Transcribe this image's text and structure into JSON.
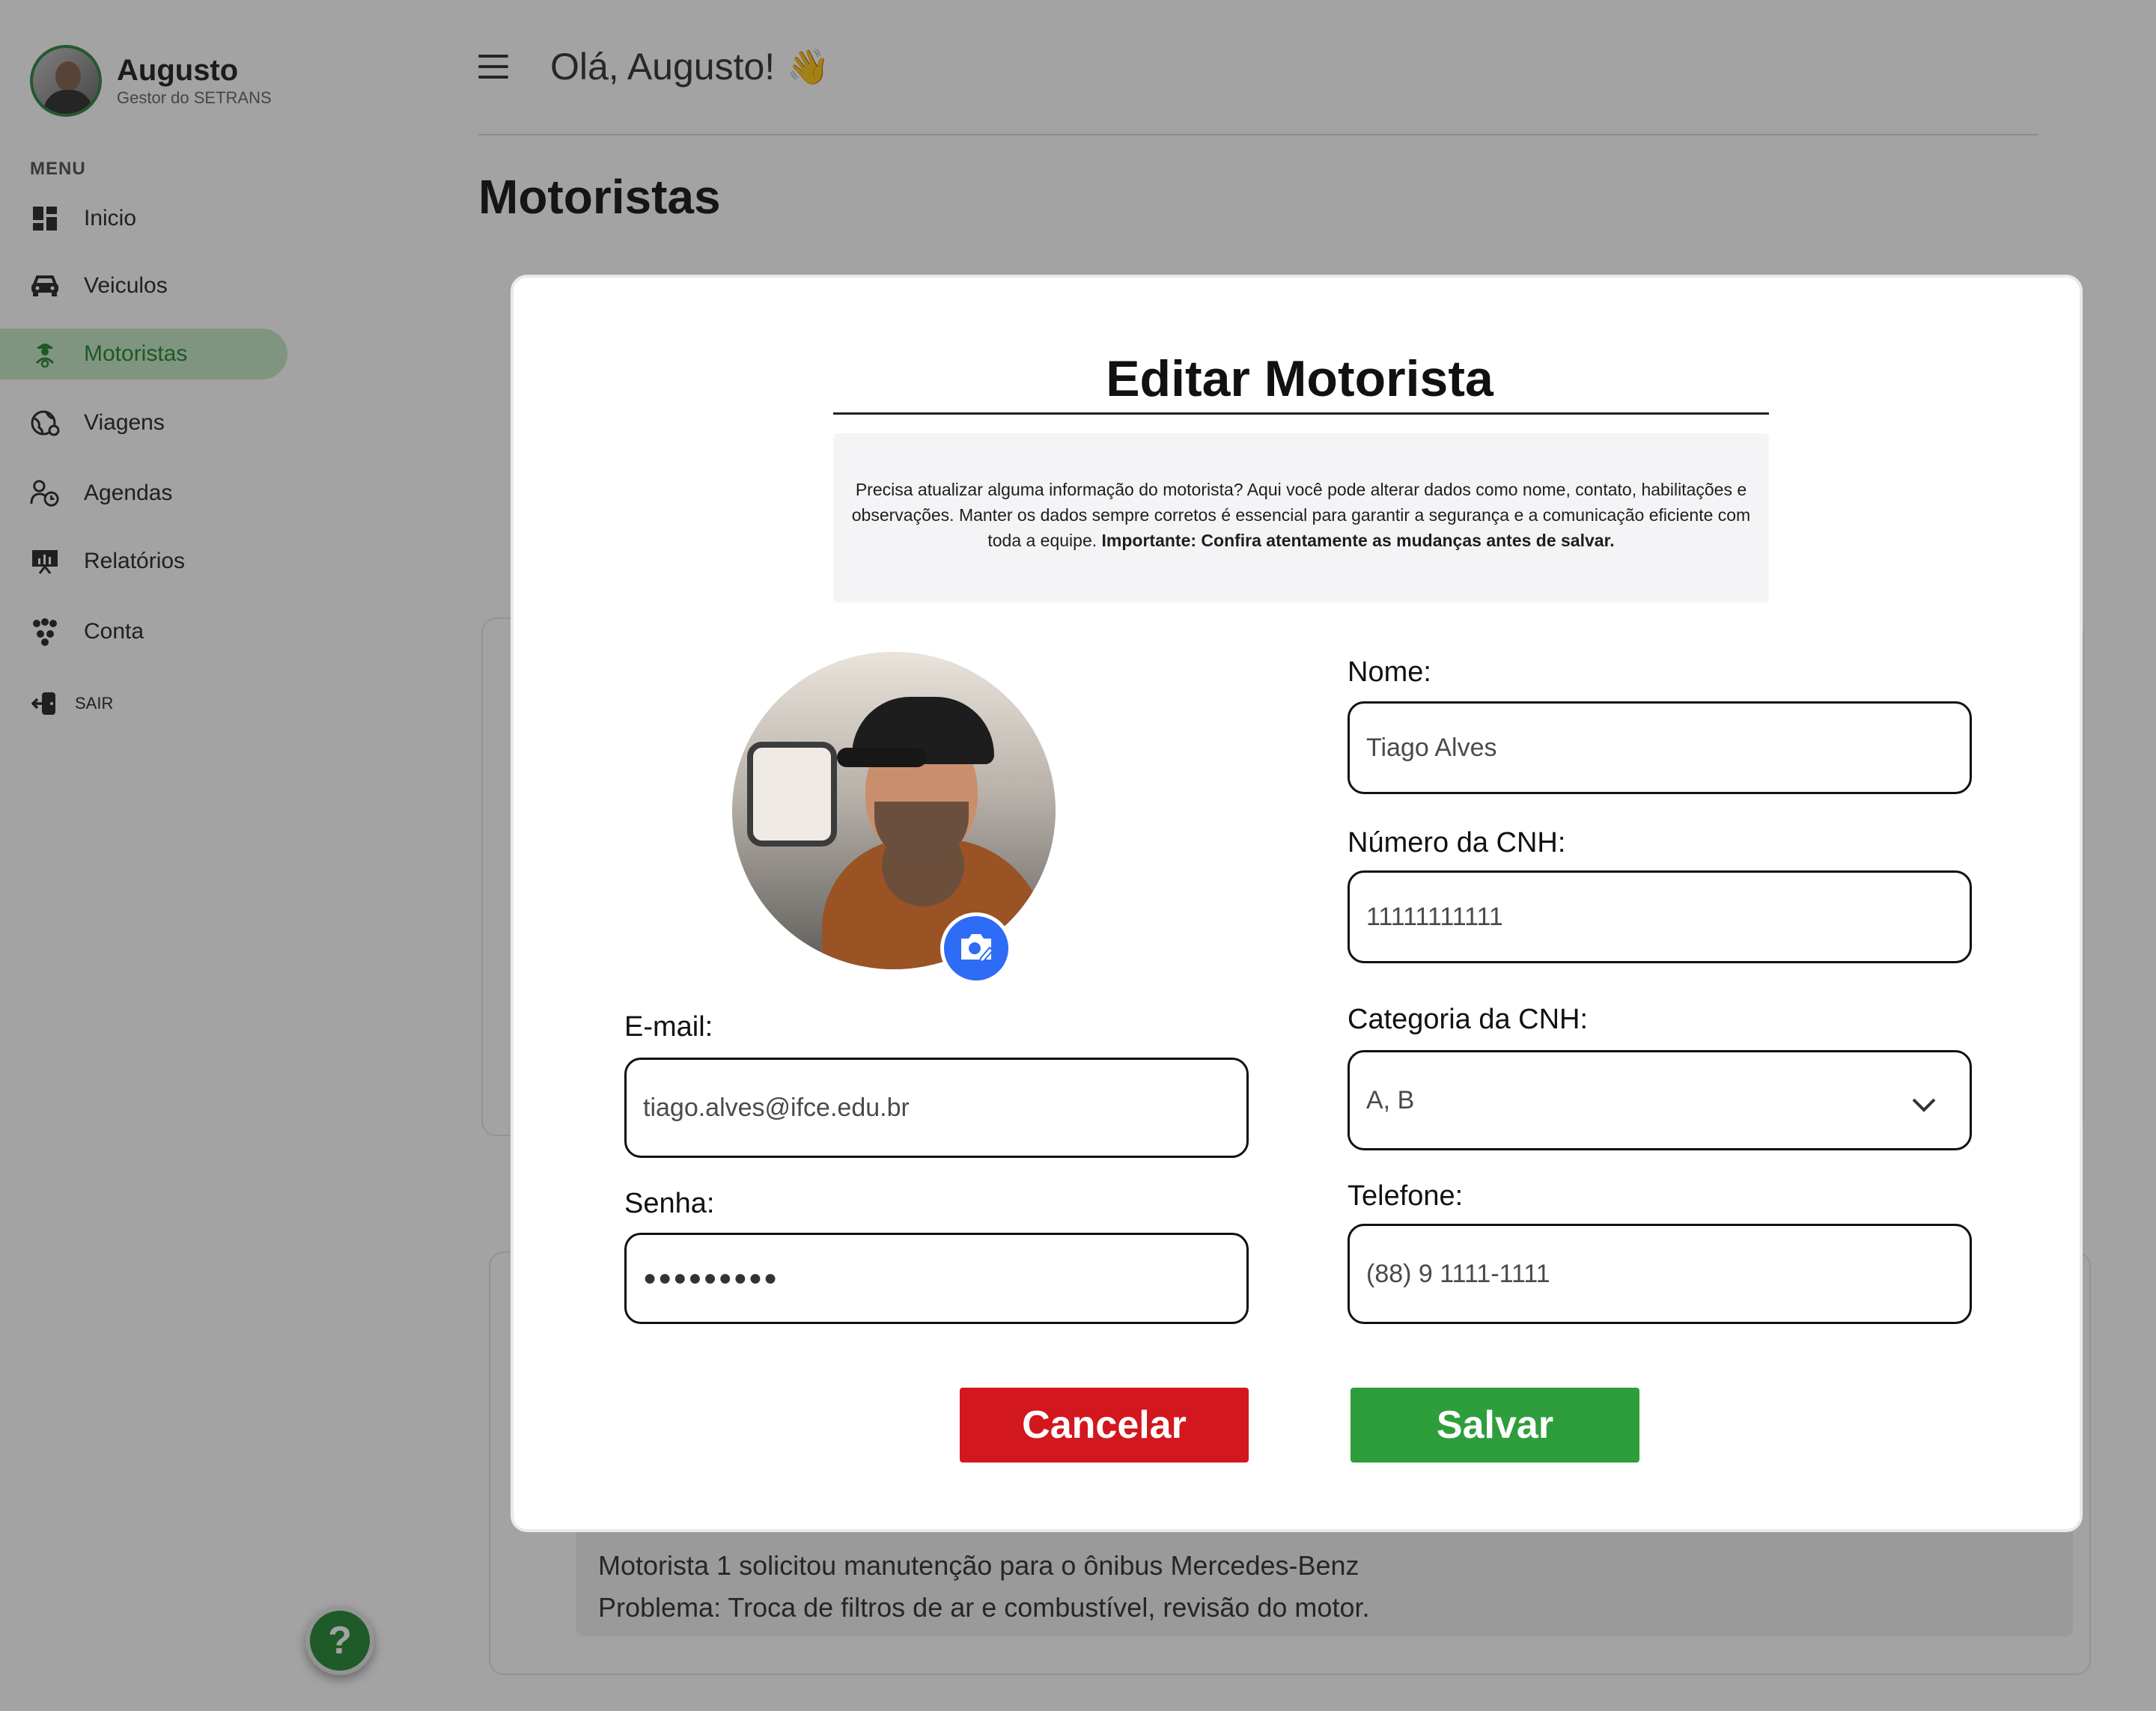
{
  "user": {
    "name": "Augusto",
    "role": "Gestor do SETRANS"
  },
  "menu": {
    "title": "MENU",
    "items": [
      {
        "label": "Inicio",
        "icon": "dashboard-icon"
      },
      {
        "label": "Veiculos",
        "icon": "car-icon"
      },
      {
        "label": "Motoristas",
        "icon": "driver-icon",
        "active": true
      },
      {
        "label": "Viagens",
        "icon": "globe-icon"
      },
      {
        "label": "Agendas",
        "icon": "schedule-icon"
      },
      {
        "label": "Relatórios",
        "icon": "report-icon"
      },
      {
        "label": "Conta",
        "icon": "account-icon"
      }
    ],
    "logout_label": "SAIR"
  },
  "header": {
    "greeting": "Olá, Augusto!",
    "emoji": "👋"
  },
  "page": {
    "title": "Motoristas"
  },
  "background_note": {
    "line1": "Motorista 1 solicitou manutenção para o ônibus Mercedes-Benz",
    "line2": "Problema: Troca de filtros de ar e combustível, revisão do motor."
  },
  "modal": {
    "title": "Editar Motorista",
    "info_text": "Precisa atualizar alguma informação do motorista? Aqui você pode alterar dados como nome, contato, habilitações e observações. Manter os dados sempre corretos é essencial para garantir a segurança e a comunicação eficiente com toda a equipe.",
    "info_important": "Importante: Confira atentamente as mudanças antes de salvar.",
    "fields": {
      "nome": {
        "label": "Nome:",
        "value": "Tiago Alves"
      },
      "cnh_numero": {
        "label": "Número da CNH:",
        "value": "11111111111"
      },
      "cnh_categoria": {
        "label": "Categoria da CNH:",
        "value": "A, B"
      },
      "telefone": {
        "label": "Telefone:",
        "value": "(88) 9 1111-1111"
      },
      "email": {
        "label": "E-mail:",
        "value": "tiago.alves@ifce.edu.br"
      },
      "senha": {
        "label": "Senha:",
        "value": "●●●●●●●●●"
      }
    },
    "buttons": {
      "cancel": "Cancelar",
      "save": "Salvar"
    }
  },
  "help": {
    "label": "?"
  },
  "colors": {
    "accent_green": "#2f8a3c",
    "active_bg": "#c8e9c9",
    "cancel_red": "#d3171e",
    "save_green": "#2e9e3c",
    "camera_blue": "#2e6cf6"
  }
}
